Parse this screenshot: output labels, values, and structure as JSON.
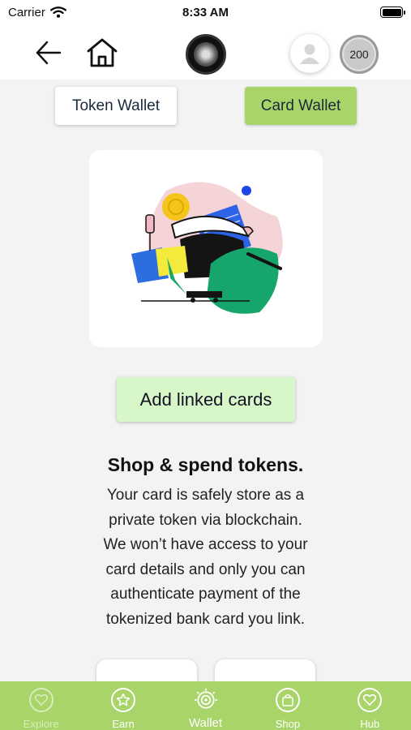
{
  "status_bar": {
    "carrier": "Carrier",
    "time": "8:33 AM"
  },
  "header": {
    "back_icon": "arrow-left-icon",
    "home_icon": "home-icon",
    "logo": "brand-logo",
    "avatar_icon": "user-icon",
    "token_count": "200"
  },
  "tabs": {
    "token_wallet": "Token Wallet",
    "card_wallet": "Card Wallet",
    "active": "card_wallet"
  },
  "illustration": {
    "name": "shopping-illustration"
  },
  "add_linked_cards": "Add linked cards",
  "info": {
    "title": "Shop & spend tokens.",
    "lines": [
      "Your card is safely store as a",
      "private token via blockchain.",
      "We won’t have access to your",
      "card details and only you can",
      "authenticate payment of the",
      "tokenized bank card you link."
    ]
  },
  "bottom_nav": {
    "items": [
      {
        "label": "Explore",
        "icon": "explore-icon",
        "state": "muted"
      },
      {
        "label": "Earn",
        "icon": "star-icon",
        "state": "normal"
      },
      {
        "label": "Wallet",
        "icon": "wallet-icon",
        "state": "active"
      },
      {
        "label": "Shop",
        "icon": "shopping-bag-icon",
        "state": "normal"
      },
      {
        "label": "Hub",
        "icon": "heart-icon",
        "state": "normal"
      }
    ]
  },
  "colors": {
    "accent_green": "#a9d46a",
    "button_light_green": "#d8f7c9",
    "background": "#f3f3f3"
  }
}
